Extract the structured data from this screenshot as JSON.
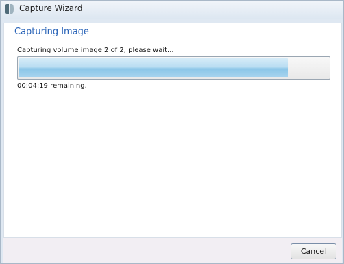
{
  "window": {
    "title": "Capture Wizard",
    "icon": "capture-wizard-app-icon"
  },
  "page": {
    "title": "Capturing Image",
    "status": "Capturing volume image 2 of 2, please wait...",
    "remaining": "00:04:19 remaining."
  },
  "progress": {
    "fraction": 0.87
  },
  "footer": {
    "cancel_label": "Cancel"
  },
  "colors": {
    "title_accent": "#2a64b8",
    "progress_fill": "#8cc6e8"
  }
}
